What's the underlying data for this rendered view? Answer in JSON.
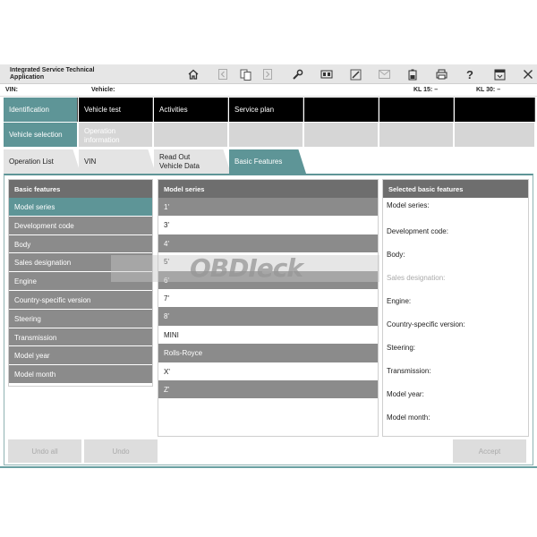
{
  "app": {
    "title_line1": "Integrated Service Technical",
    "title_line2": "Application"
  },
  "toolbar": {
    "icons": [
      "home-icon",
      "back-icon",
      "copy-icon",
      "forward-icon",
      "wrench-icon",
      "vehicle-icon",
      "link-icon",
      "mail-icon",
      "battery-icon",
      "print-icon",
      "help-icon",
      "window-icon",
      "close-icon"
    ],
    "help": "?"
  },
  "infobar": {
    "vin_label": "VIN:",
    "vehicle_label": "Vehicle:",
    "kl15": "KL 15:  –",
    "kl30": "KL 30:  –"
  },
  "tabs1": [
    "Identification",
    "Vehicle test",
    "Activities",
    "Service plan"
  ],
  "tabs2": {
    "vehicle_selection": "Vehicle selection",
    "operation_information_1": "Operation",
    "operation_information_2": "information"
  },
  "tabs3": {
    "operation_list": "Operation List",
    "vin": "VIN",
    "read_out_1": "Read Out",
    "read_out_2": "Vehicle Data",
    "basic_features": "Basic Features"
  },
  "left_panel": {
    "header": "Basic features",
    "items": [
      "Model series",
      "Development code",
      "Body",
      "Sales designation",
      "Engine",
      "Country-specific version",
      "Steering",
      "Transmission",
      "Model year",
      "Model month"
    ]
  },
  "middle_panel": {
    "header": "Model series",
    "items": [
      "1'",
      "3'",
      "4'",
      "5'",
      "6'",
      "7'",
      "8'",
      "MINI",
      "Rolls-Royce",
      "X'",
      "Z'"
    ]
  },
  "right_panel": {
    "header": "Selected basic features",
    "items": [
      "Model series:",
      "Development code:",
      "Body:",
      "Sales designation:",
      "Engine:",
      "Country-specific version:",
      "Steering:",
      "Transmission:",
      "Model year:",
      "Model month:"
    ]
  },
  "buttons": {
    "undo_all": "Undo all",
    "undo": "Undo",
    "accept": "Accept"
  },
  "watermark": "OBDIeck",
  "colors": {
    "accent": "#5e9597",
    "header_gray": "#6e6e6e",
    "row_gray": "#8b8b8b",
    "tab_black": "#000000"
  }
}
